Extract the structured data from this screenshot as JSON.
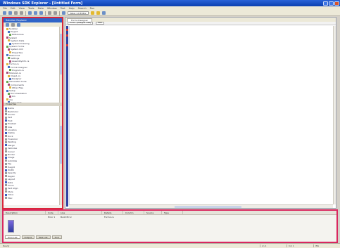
{
  "window": {
    "title": "Windows SDK Explorer - [Untitled Form]"
  },
  "menu": {
    "items": [
      "File",
      "Edit",
      "View",
      "Tools",
      "Data",
      "Window",
      "Test",
      "Help",
      "Search",
      "Run"
    ]
  },
  "toolbar": {
    "combo": "Value 1.0 Editor"
  },
  "left_pane": {
    "header": "Solution Explorer",
    "tree_items": [
      "Solution",
      "Project",
      "References",
      "System",
      "System.Data",
      "System.Drawing",
      "System.Forms",
      "System.Xml",
      "Properties",
      "Resources",
      "Settings",
      "AssemblyInfo.cs",
      "Form1.cs",
      "Form1.Designer",
      "Program.cs",
      "Module1.cs",
      "Class1.cs",
      "Designer",
      "Generated Code",
      "Components",
      "Other Files",
      "Setup",
      "Documentation",
      "bin",
      "obj",
      "Output.txt"
    ],
    "properties_header": "Properties",
    "property_items": [
      "Name",
      "BackColor",
      "Anchor",
      "Text",
      "Font",
      "Enabled",
      "Size",
      "Location",
      "Visible",
      "Dock",
      "ForeColor",
      "Padding",
      "Margin",
      "TabIndex",
      "Cursor",
      "Border",
      "Image",
      "AutoSize",
      "Tag",
      "Height",
      "Width",
      "Opacity",
      "Region",
      "Layout",
      "Data",
      "Focus",
      "Text Align",
      "Style",
      "Value",
      "Misc"
    ]
  },
  "document": {
    "tab_label": "Form1 Designer",
    "nav_left": "Form1 - [Designer View]",
    "nav_right": "Main"
  },
  "output": {
    "headers": [
      "Description",
      "Code",
      "Line",
      "Details",
      "Column",
      "Source",
      "Type"
    ],
    "row": [
      "Error 1",
      "Build Error",
      "Form1.cs"
    ],
    "tabs": [
      "Error List",
      "Output",
      "Task List",
      "Find"
    ]
  },
  "status": {
    "text": "Ready",
    "cells": [
      "Ln 1",
      "Col 1",
      "INS"
    ]
  },
  "colors": {
    "accent": "#2f64c8",
    "highlight_red": "#d9273b",
    "gutter": "#2f3fa0"
  }
}
